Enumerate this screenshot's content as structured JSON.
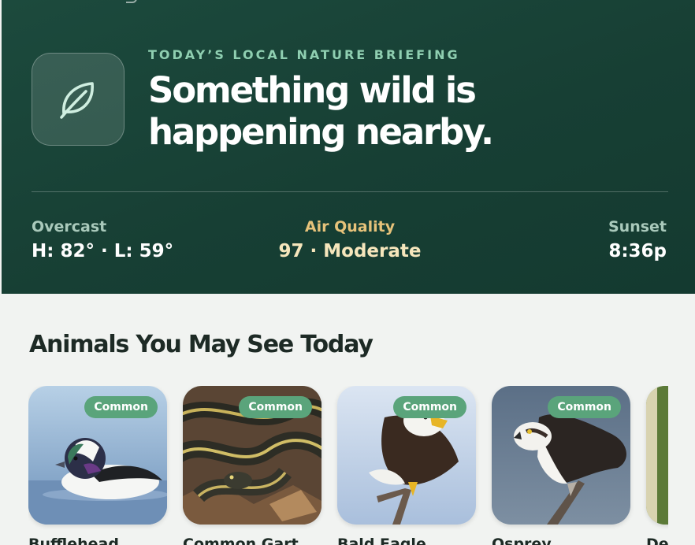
{
  "hero": {
    "eyebrow": "TODAY’S LOCAL NATURE BRIEFING",
    "headline": "Something wild is happening nearby.",
    "icon": "leaf-icon"
  },
  "stats": {
    "weather": {
      "label": "Overcast",
      "value": "H: 82° · L: 59°"
    },
    "air_quality": {
      "label": "Air Quality",
      "value": "97 · Moderate"
    },
    "sunset": {
      "label": "Sunset",
      "value": "8:36p"
    }
  },
  "animals": {
    "title": "Animals You May See Today",
    "items": [
      {
        "name": "Bufflehead",
        "badge": "Common"
      },
      {
        "name": "Common Gart",
        "badge": "Common"
      },
      {
        "name": "Bald Eagle",
        "badge": "Common"
      },
      {
        "name": "Osprey",
        "badge": "Common"
      },
      {
        "name": "De",
        "badge": ""
      }
    ]
  },
  "colors": {
    "hero_bg": "#1a4539",
    "accent_green": "#5aa47b",
    "eyebrow": "#8fcfb1",
    "air_quality_label": "#e6c27a",
    "page_bg": "#f1f3f1"
  }
}
